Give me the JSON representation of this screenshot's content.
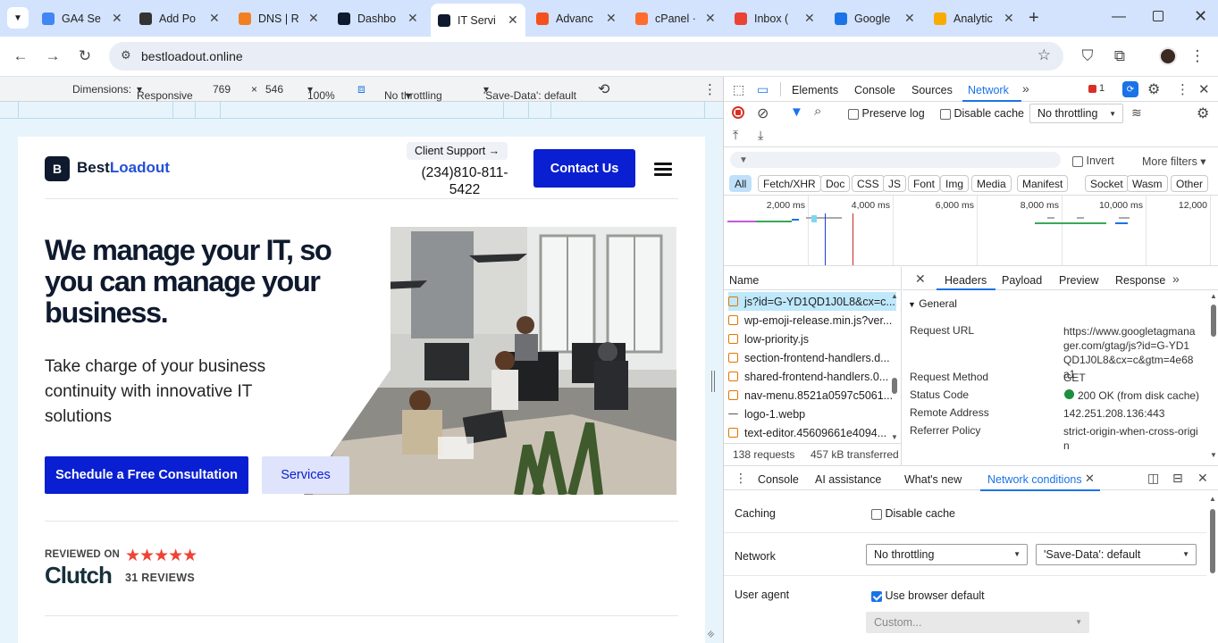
{
  "browser": {
    "tabs": [
      {
        "title": "GA4 Se",
        "icon": "ga4-icon",
        "color": "#4285f4"
      },
      {
        "title": "Add Po",
        "icon": "site-icon",
        "color": "#333333"
      },
      {
        "title": "DNS | R",
        "icon": "cloudflare-icon",
        "color": "#f38020"
      },
      {
        "title": "Dashbo",
        "icon": "bestloadout-icon",
        "color": "#0f1a2e"
      },
      {
        "title": "IT Servi",
        "icon": "bestloadout-icon",
        "color": "#0f1a2e",
        "active": true
      },
      {
        "title": "Advanc",
        "icon": "advanced-icon",
        "color": "#f4511e"
      },
      {
        "title": "cPanel ·",
        "icon": "cpanel-icon",
        "color": "#ff6c2c"
      },
      {
        "title": "Inbox (",
        "icon": "gmail-icon",
        "color": "#ea4335"
      },
      {
        "title": "Google",
        "icon": "google-icon",
        "color": "#1a73e8"
      },
      {
        "title": "Analytic",
        "icon": "analytics-icon",
        "color": "#f9ab00"
      }
    ],
    "url": "bestloadout.online"
  },
  "device_toolbar": {
    "dimensions_label": "Dimensions:",
    "dimensions_value": "Responsive",
    "width": "769",
    "times": "×",
    "height": "546",
    "zoom": "100%",
    "throttling": "No throttling",
    "save_data": "'Save-Data': default"
  },
  "site": {
    "logo_letter": "B",
    "brand_part1": "Best",
    "brand_part2": "Loadout",
    "client_support": "Client Support →",
    "phone": "(234)810-811-5422",
    "contact_button": "Contact Us",
    "hero_title": "We manage your IT, so you can manage your business.",
    "hero_subtitle": "Take charge of your business continuity with innovative IT solutions",
    "primary_button": "Schedule a Free Consultation",
    "secondary_button": "Services",
    "reviewed_on": "REVIEWED ON",
    "stars": "★★★★★",
    "clutch_name": "Clutch",
    "reviews_count": "31 REVIEWS"
  },
  "devtools": {
    "main_tabs": [
      "Elements",
      "Console",
      "Sources",
      "Network"
    ],
    "selected_tab": "Network",
    "issues_count": "1",
    "preserve_log": "Preserve log",
    "disable_cache": "Disable cache",
    "throttling": "No throttling",
    "filter_placeholder": "Filter",
    "invert": "Invert",
    "more_filters": "More filters",
    "filter_chips": [
      "All",
      "Fetch/XHR",
      "Doc",
      "CSS",
      "JS",
      "Font",
      "Img",
      "Media",
      "Manifest",
      "Socket",
      "Wasm",
      "Other"
    ],
    "timeline_labels": [
      "2,000 ms",
      "4,000 ms",
      "6,000 ms",
      "8,000 ms",
      "10,000 ms",
      "12,000"
    ],
    "name_header": "Name",
    "requests": [
      "js?id=G-YD1QD1J0L8&cx=c...",
      "wp-emoji-release.min.js?ver...",
      "low-priority.js",
      "section-frontend-handlers.d...",
      "shared-frontend-handlers.0...",
      "nav-menu.8521a0597c5061...",
      "logo-1.webp",
      "text-editor.45609661e4094..."
    ],
    "requests_count": "138 requests",
    "transferred": "457 kB transferred",
    "detail_tabs": [
      "Headers",
      "Payload",
      "Preview",
      "Response"
    ],
    "general_label": "General",
    "headers": [
      {
        "key": "Request URL",
        "value": "https://www.googletagmanager.com/gtag/js?id=G-YD1QD1J0L8&cx=c&gtm=4e68a1"
      },
      {
        "key": "Request Method",
        "value": "GET"
      },
      {
        "key": "Status Code",
        "value": "200 OK (from disk cache)"
      },
      {
        "key": "Remote Address",
        "value": "142.251.208.136:443"
      },
      {
        "key": "Referrer Policy",
        "value": "strict-origin-when-cross-origin"
      }
    ],
    "drawer_tabs": [
      "Console",
      "AI assistance",
      "What's new",
      "Network conditions"
    ],
    "nc": {
      "caching_label": "Caching",
      "disable_cache": "Disable cache",
      "network_label": "Network",
      "network_value": "No throttling",
      "save_data": "'Save-Data': default",
      "user_agent_label": "User agent",
      "use_default": "Use browser default",
      "custom_placeholder": "Custom..."
    }
  }
}
